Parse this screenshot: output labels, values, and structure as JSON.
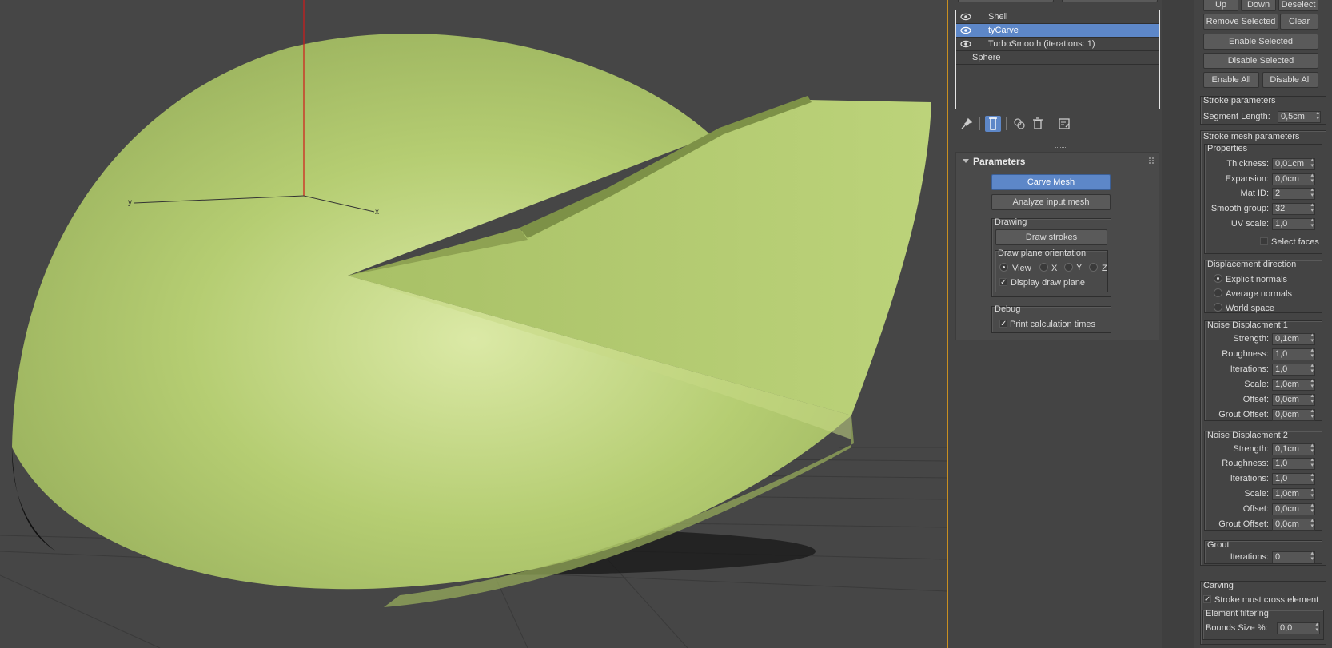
{
  "stack": {
    "items": [
      {
        "label": "Shell",
        "visible": true,
        "selected": false
      },
      {
        "label": "tyCarve",
        "visible": true,
        "selected": true
      },
      {
        "label": "TurboSmooth (iterations: 1)",
        "visible": true,
        "selected": false
      },
      {
        "label": "Sphere",
        "visible": false,
        "selected": false
      }
    ]
  },
  "stack_tools": {
    "icons": [
      "pin-stack-icon",
      "show-end-result-icon",
      "make-unique-icon",
      "remove-modifier-icon",
      "configure-modifier-sets-icon"
    ]
  },
  "viewport": {
    "axis_x": "x",
    "axis_y": "y",
    "object_color": "#b7cf72"
  },
  "parameters": {
    "title": "Parameters",
    "carve_mesh": "Carve Mesh",
    "analyze_input_mesh": "Analyze input mesh",
    "drawing": {
      "title": "Drawing",
      "draw_strokes": "Draw strokes",
      "orientation_title": "Draw plane orientation",
      "options": [
        "View",
        "X",
        "Y",
        "Z"
      ],
      "selected_option": "View",
      "display_draw_plane": "Display draw plane"
    },
    "debug": {
      "title": "Debug",
      "print_times": "Print calculation times"
    }
  },
  "right": {
    "buttons": {
      "up": "Up",
      "down": "Down",
      "deselect": "Deselect",
      "remove_selected": "Remove Selected",
      "clear": "Clear",
      "enable_selected": "Enable Selected",
      "disable_selected": "Disable Selected",
      "enable_all": "Enable All",
      "disable_all": "Disable All"
    },
    "stroke_params": {
      "title": "Stroke parameters",
      "segment_length_label": "Segment Length:",
      "segment_length": "0,5cm"
    },
    "stroke_mesh": {
      "title": "Stroke mesh parameters",
      "properties_title": "Properties",
      "thickness_label": "Thickness:",
      "thickness": "0,01cm",
      "expansion_label": "Expansion:",
      "expansion": "0,0cm",
      "matid_label": "Mat ID:",
      "matid": "2",
      "smooth_label": "Smooth group:",
      "smooth": "32",
      "uvscale_label": "UV scale:",
      "uvscale": "1,0",
      "select_faces": "Select faces"
    },
    "displacement": {
      "title": "Displacement direction",
      "options": [
        "Explicit normals",
        "Average normals",
        "World space"
      ]
    },
    "noise1": {
      "title": "Noise Displacment 1",
      "rows": [
        {
          "label": "Strength:",
          "value": "0,1cm"
        },
        {
          "label": "Roughness:",
          "value": "1,0"
        },
        {
          "label": "Iterations:",
          "value": "1,0"
        },
        {
          "label": "Scale:",
          "value": "1,0cm"
        },
        {
          "label": "Offset:",
          "value": "0,0cm"
        },
        {
          "label": "Grout Offset:",
          "value": "0,0cm"
        }
      ]
    },
    "noise2": {
      "title": "Noise Displacment 2",
      "rows": [
        {
          "label": "Strength:",
          "value": "0,1cm"
        },
        {
          "label": "Roughness:",
          "value": "1,0"
        },
        {
          "label": "Iterations:",
          "value": "1,0"
        },
        {
          "label": "Scale:",
          "value": "1,0cm"
        },
        {
          "label": "Offset:",
          "value": "0,0cm"
        },
        {
          "label": "Grout Offset:",
          "value": "0,0cm"
        }
      ]
    },
    "grout": {
      "title": "Grout",
      "iterations_label": "Iterations:",
      "iterations": "0"
    },
    "carving": {
      "title": "Carving",
      "stroke_cross": "Stroke must cross element",
      "filter_title": "Element filtering",
      "bounds_label": "Bounds Size %:",
      "bounds": "0,0"
    }
  }
}
